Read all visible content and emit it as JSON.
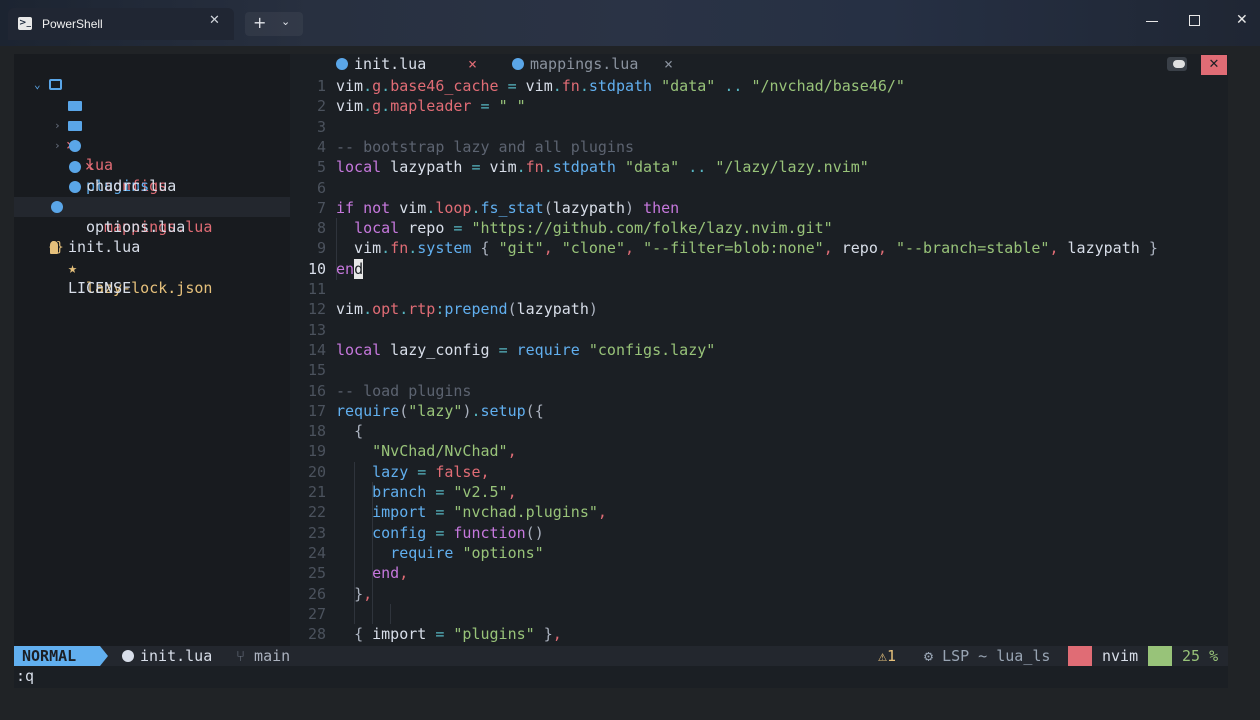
{
  "window": {
    "tab_title": "PowerShell",
    "tab_close": "✕",
    "new_tab": "+",
    "dropdown": "⌄",
    "close": "✕"
  },
  "tree": {
    "root": {
      "label": "lua",
      "chevron": "⌄",
      "mark": "×"
    },
    "items": [
      {
        "label": "configs",
        "chevron": "›",
        "icon": "folder-icon",
        "mark": "×"
      },
      {
        "label": "plugins",
        "chevron": "›",
        "icon": "folder-icon",
        "mark": ""
      },
      {
        "label": "chadrc.lua",
        "icon": "lua-icon",
        "mark": ""
      },
      {
        "label": "mappings.lua",
        "icon": "lua-icon",
        "mark": "×"
      },
      {
        "label": "options.lua",
        "icon": "lua-icon",
        "mark": ""
      },
      {
        "label": "init.lua",
        "icon": "lua-icon",
        "mark": ""
      },
      {
        "label": "lazy-lock.json",
        "icon": "json-icon",
        "prefix": "{}",
        "star": "★"
      },
      {
        "label": "LICENSE",
        "icon": "license-icon",
        "glyph": "🯅"
      }
    ]
  },
  "editor_tabs": [
    {
      "label": "init.lua",
      "close": "×",
      "active": true
    },
    {
      "label": "mappings.lua",
      "close": "×",
      "active": false
    }
  ],
  "editor_close_all": "✕",
  "code": {
    "lines": [
      "vim.g.base46_cache = vim.fn.stdpath \"data\" .. \"/nvchad/base46/\"",
      "vim.g.mapleader = \" \"",
      "",
      "-- bootstrap lazy and all plugins",
      "local lazypath = vim.fn.stdpath \"data\" .. \"/lazy/lazy.nvim\"",
      "",
      "if not vim.loop.fs_stat(lazypath) then",
      "  local repo = \"https://github.com/folke/lazy.nvim.git\"",
      "  vim.fn.system { \"git\", \"clone\", \"--filter=blob:none\", repo, \"--branch=stable\", lazypath }",
      "end",
      "",
      "vim.opt.rtp:prepend(lazypath)",
      "",
      "local lazy_config = require \"configs.lazy\"",
      "",
      "-- load plugins",
      "require(\"lazy\").setup({",
      "  {",
      "    \"NvChad/NvChad\",",
      "    lazy = false,",
      "    branch = \"v2.5\",",
      "    import = \"nvchad.plugins\",",
      "    config = function()",
      "      require \"options\"",
      "    end,",
      "  },",
      "",
      "  { import = \"plugins\" },"
    ],
    "line_numbers": [
      "1",
      "2",
      "3",
      "4",
      "5",
      "6",
      "7",
      "8",
      "9",
      "10",
      "11",
      "12",
      "13",
      "14",
      "15",
      "16",
      "17",
      "18",
      "19",
      "20",
      "21",
      "22",
      "23",
      "24",
      "25",
      "26",
      "27",
      "28"
    ],
    "current_line": "10"
  },
  "statusline": {
    "mode": "NORMAL",
    "file": "init.lua",
    "branch": "main",
    "warnings": "1",
    "lsp": "LSP ~ lua_ls",
    "cwd": "nvim",
    "position": "25 %"
  },
  "cmdline": ":q"
}
